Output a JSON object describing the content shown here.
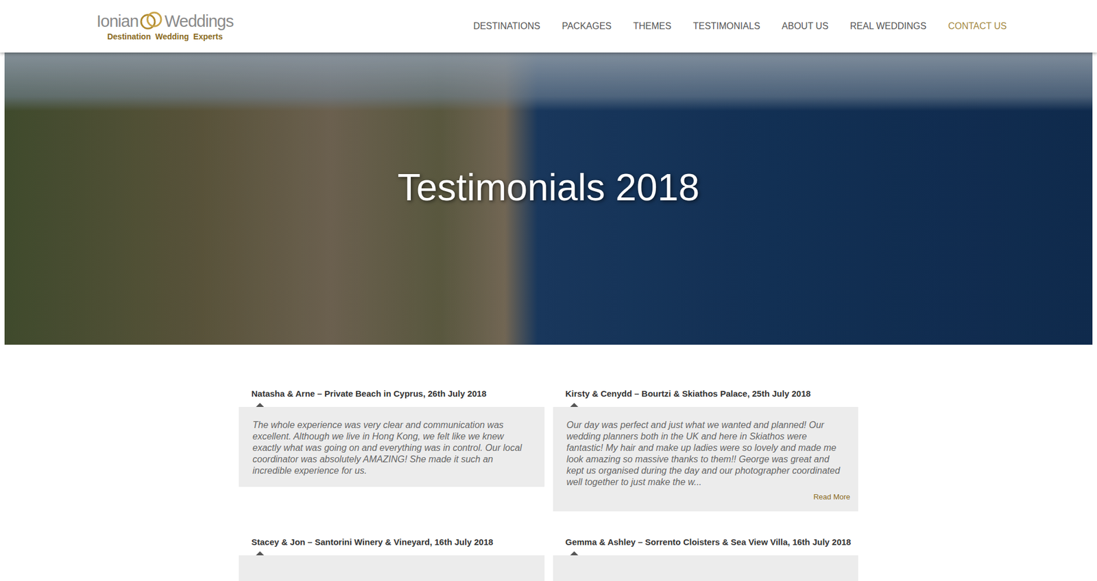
{
  "header": {
    "logo": {
      "name_left": "Ionian",
      "name_right": "Weddings",
      "tagline": "Destination  Wedding  Experts"
    },
    "nav": [
      {
        "label": "DESTINATIONS",
        "highlighted": false
      },
      {
        "label": "PACKAGES",
        "highlighted": false
      },
      {
        "label": "THEMES",
        "highlighted": false
      },
      {
        "label": "TESTIMONIALS",
        "highlighted": false
      },
      {
        "label": "ABOUT US",
        "highlighted": false
      },
      {
        "label": "REAL WEDDINGS",
        "highlighted": false
      },
      {
        "label": "CONTACT US",
        "highlighted": true
      }
    ]
  },
  "hero": {
    "title": "Testimonials 2018"
  },
  "testimonials": [
    {
      "title": "Natasha & Arne – Private Beach in Cyprus, 26th July 2018",
      "quote": "The whole experience was very clear and communication was excellent. Although we live in Hong Kong, we felt like we knew exactly what was going on and everything was in control. Our local coordinator was absolutely AMAZING! She made it such an incredible experience for us.",
      "read_more": ""
    },
    {
      "title": "Kirsty & Cenydd – Bourtzi & Skiathos Palace, 25th July 2018",
      "quote": "Our day was perfect and just what we wanted and planned! Our wedding planners both in the UK and here in Skiathos were fantastic! My hair and make up ladies were so lovely and made me look amazing so massive thanks to them!! George was great and kept us organised during the day and our photographer coordinated well together to just make the w...",
      "read_more": "Read More"
    },
    {
      "title": "Stacey & Jon – Santorini Winery & Vineyard, 16th July 2018",
      "quote": "",
      "read_more": ""
    },
    {
      "title": "Gemma & Ashley – Sorrento Cloisters & Sea View Villa, 16th July 2018",
      "quote": "",
      "read_more": ""
    }
  ]
}
